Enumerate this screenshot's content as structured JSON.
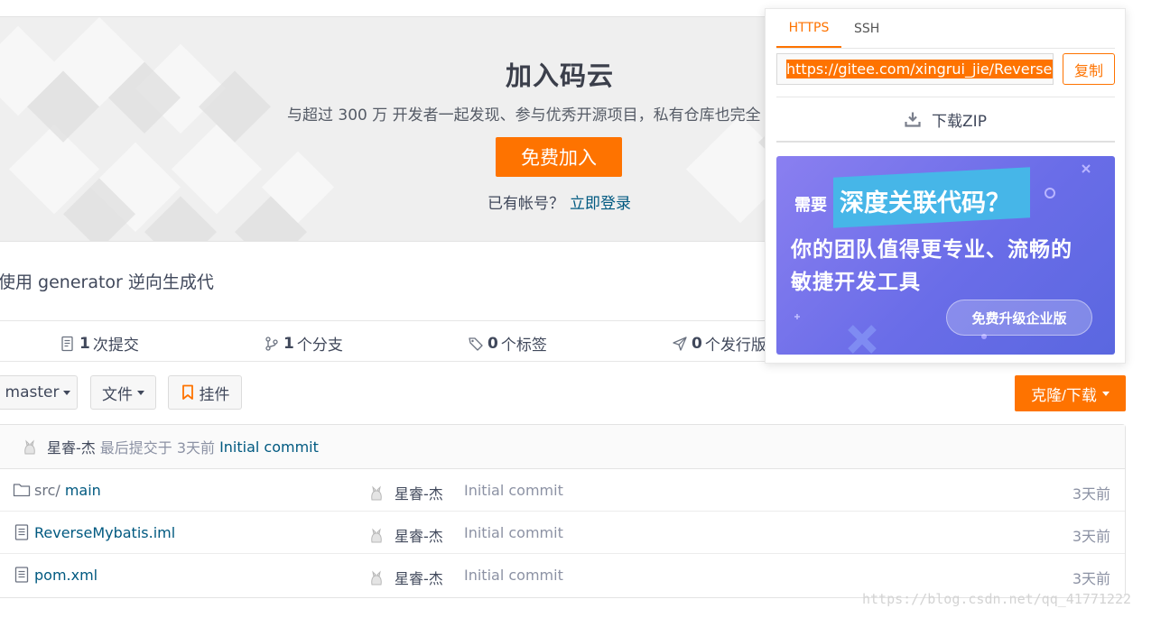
{
  "hero": {
    "title": "加入码云",
    "subtitle": "与超过 300 万 开发者一起发现、参与优秀开源项目，私有仓库也完全",
    "join_label": "免费加入",
    "have_account": "已有帐号？",
    "login_label": "立即登录"
  },
  "repo": {
    "description": "使用 generator 逆向生成代"
  },
  "stats": {
    "commits": {
      "count": "1",
      "label": "次提交"
    },
    "branches": {
      "count": "1",
      "label": "个分支"
    },
    "tags": {
      "count": "0",
      "label": "个标签"
    },
    "releases": {
      "count": "0",
      "label": "个发行版"
    }
  },
  "toolbar": {
    "branch": "master",
    "file_menu": "文件",
    "widget": "挂件",
    "clone_label": "克隆/下载"
  },
  "last_commit": {
    "author": "星睿-杰",
    "meta": "最后提交于 3天前",
    "message": "Initial commit"
  },
  "files": [
    {
      "prefix": "src/",
      "name": "main",
      "type": "folder",
      "author": "星睿-杰",
      "message": "Initial commit",
      "time": "3天前"
    },
    {
      "prefix": "",
      "name": "ReverseMybatis.iml",
      "type": "file",
      "author": "星睿-杰",
      "message": "Initial commit",
      "time": "3天前"
    },
    {
      "prefix": "",
      "name": "pom.xml",
      "type": "file",
      "author": "星睿-杰",
      "message": "Initial commit",
      "time": "3天前"
    }
  ],
  "clone_popup": {
    "tabs": [
      "HTTPS",
      "SSH"
    ],
    "active_tab": "HTTPS",
    "url": "https://gitee.com/xingrui_jie/ReverseMybatis.git",
    "copy_label": "复制",
    "zip_label": "下载ZIP"
  },
  "ad": {
    "need": "需要",
    "highlight": "深度关联代码？",
    "line1": "你的团队值得更专业、流畅的",
    "line2": "敏捷开发工具",
    "cta": "免费升级企业版"
  },
  "watermark": "https://blog.csdn.net/qq_41771222",
  "colors": {
    "accent": "#fe7300",
    "link": "#005980",
    "muted": "#8c92a4",
    "text": "#40485b"
  }
}
